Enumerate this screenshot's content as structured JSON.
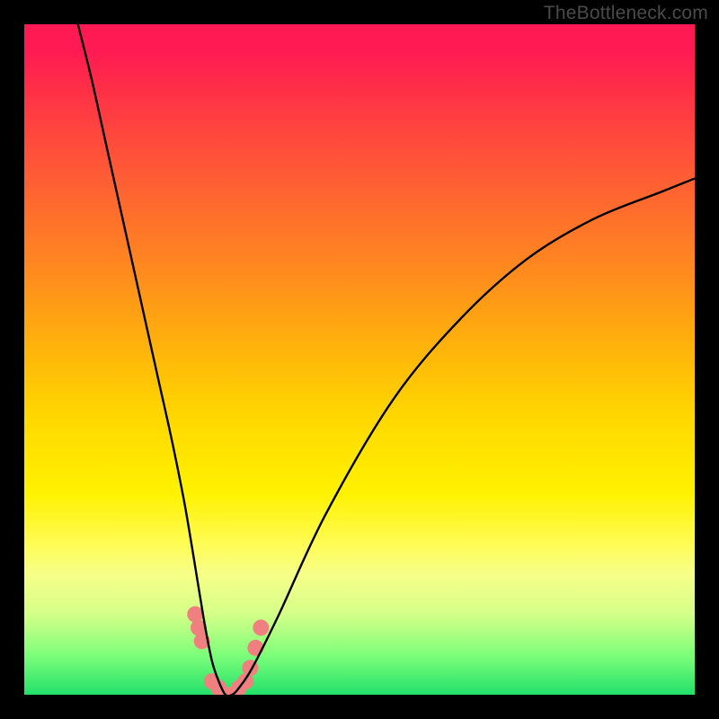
{
  "watermark": "TheBottleneck.com",
  "chart_data": {
    "type": "line",
    "title": "",
    "xlabel": "",
    "ylabel": "",
    "xlim": [
      0,
      100
    ],
    "ylim": [
      0,
      100
    ],
    "series": [
      {
        "name": "bottleneck-curve",
        "x": [
          8,
          10,
          12,
          14,
          16,
          18,
          20,
          22,
          24,
          26,
          27,
          28,
          29,
          30,
          31,
          32,
          34,
          38,
          45,
          55,
          65,
          75,
          85,
          95,
          100
        ],
        "values": [
          100,
          92,
          83,
          74,
          65,
          56,
          47,
          38,
          28,
          16,
          10,
          5,
          2,
          0,
          0,
          1,
          4,
          12,
          27,
          44,
          56,
          65,
          71,
          75,
          77
        ]
      }
    ],
    "markers": {
      "name": "highlight-dots",
      "x": [
        25.5,
        26.0,
        26.5,
        28.0,
        29.0,
        30.0,
        31.0,
        32.0,
        33.0,
        33.7,
        34.5,
        35.3
      ],
      "values": [
        12,
        10,
        8,
        2,
        1,
        0,
        0,
        1,
        2,
        4,
        7,
        10
      ],
      "radius": 9
    }
  }
}
